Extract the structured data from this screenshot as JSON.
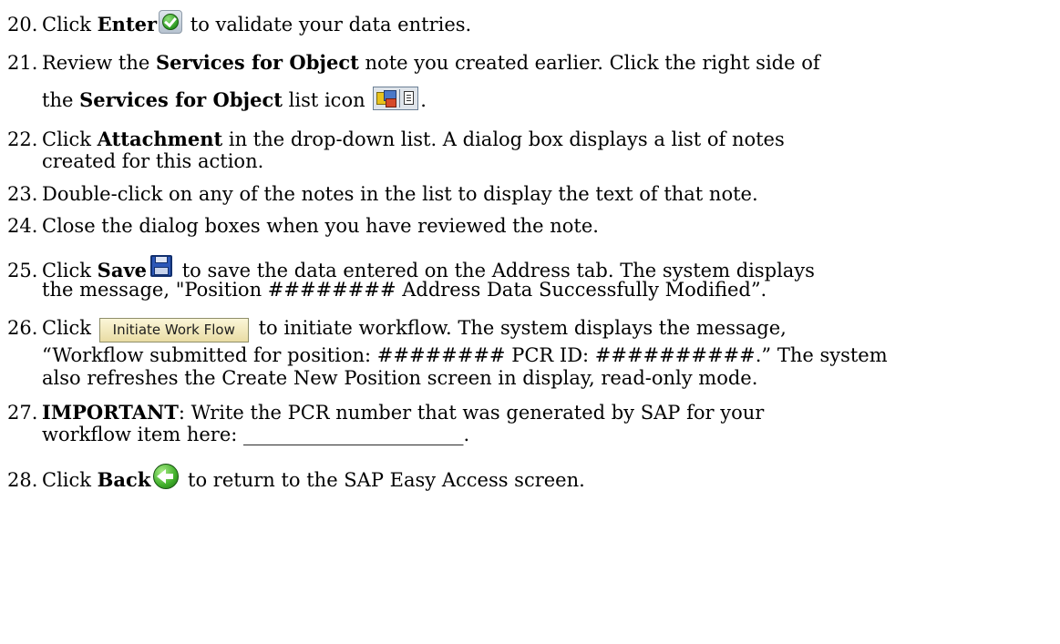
{
  "steps": {
    "s20": {
      "num": "20.",
      "t1": "Click ",
      "b1": "Enter",
      "t2": " to validate your data entries."
    },
    "s21": {
      "num": "21.",
      "t1": "Review the ",
      "b1": "Services for Object",
      "t2": " note you created earlier.  Click the right side of",
      "c1": "the ",
      "b2": "Services for Object",
      "c2": " list icon ",
      "c3": "."
    },
    "s22": {
      "num": "22.",
      "t1": "Click ",
      "b1": "Attachment",
      "t2": " in the drop-down list.  A dialog box displays a list of notes",
      "c1": "created for this action."
    },
    "s23": {
      "num": "23.",
      "t1": "Double-click on any of the notes in the list to display the text of that note."
    },
    "s24": {
      "num": "24.",
      "t1": "Close the dialog boxes when you have reviewed the note."
    },
    "s25": {
      "num": "25.",
      "t1": "Click ",
      "b1": "Save",
      "t2": " to save the data entered on the Address tab. The system displays",
      "c1": "the message, \"Position ######## Address Data Successfully Modified”."
    },
    "s26": {
      "num": "26.",
      "t1": "Click ",
      "button": "Initiate Work Flow",
      "t2": " to initiate workflow.  The system displays the message,",
      "c1": "“Workflow submitted for position: ######## PCR ID: ##########.”  The system",
      "c2": "also refreshes the Create New Position screen in display, read-only mode."
    },
    "s27": {
      "num": "27.",
      "b1": "IMPORTANT",
      "t1": ":  Write the PCR number that was generated by SAP for your",
      "c1": "workflow item here: _______________________."
    },
    "s28": {
      "num": "28.",
      "t1": "Click ",
      "b1": "Back",
      "t2": " to return to the SAP Easy Access screen."
    }
  },
  "icons": {
    "enter": "enter-check-icon",
    "services": "services-for-object-list-icon",
    "save": "save-floppy-icon",
    "back": "back-arrow-icon"
  }
}
